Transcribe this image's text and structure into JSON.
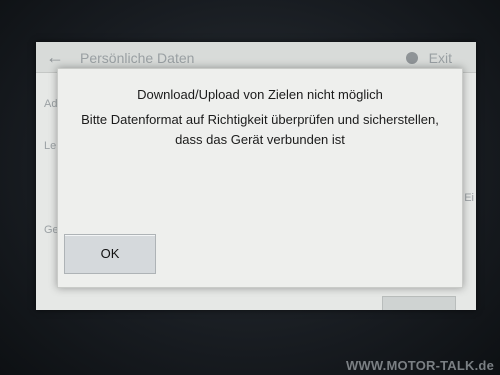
{
  "background": {
    "title": "Persönliche Daten",
    "exit_label": "Exit",
    "left_items": [
      "Ad",
      "Le",
      "Ge"
    ],
    "right_item": "Ei"
  },
  "dialog": {
    "title": "Download/Upload von Zielen nicht möglich",
    "line1": "Bitte Datenformat auf Richtigkeit überprüfen und sicherstellen,",
    "line2": "dass das Gerät verbunden ist",
    "ok_label": "OK"
  },
  "watermark": "WWW.MOTOR-TALK.de",
  "icons": {
    "back": "back-arrow-icon",
    "exit": "exit-icon"
  }
}
